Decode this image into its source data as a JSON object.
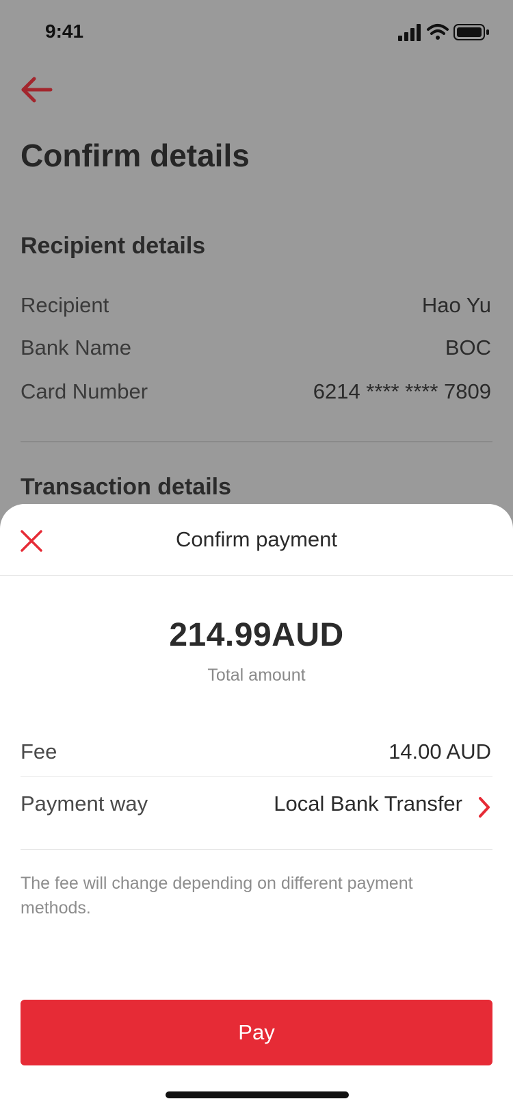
{
  "status_bar": {
    "time": "9:41"
  },
  "page": {
    "title": "Confirm details",
    "recipient_section": {
      "title": "Recipient details",
      "rows": [
        {
          "label": "Recipient",
          "value": "Hao Yu"
        },
        {
          "label": "Bank Name",
          "value": "BOC"
        },
        {
          "label": "Card Number",
          "value": "6214 **** **** 7809"
        }
      ]
    },
    "transaction_section": {
      "title": "Transaction details"
    }
  },
  "sheet": {
    "title": "Confirm payment",
    "amount": "214.99AUD",
    "amount_label": "Total amount",
    "fee": {
      "label": "Fee",
      "value": "14.00 AUD"
    },
    "payment_way": {
      "label": "Payment way",
      "value": "Local Bank Transfer"
    },
    "note": "The fee will change depending on different payment methods.",
    "pay_label": "Pay"
  },
  "colors": {
    "accent": "#e62b36",
    "overlay_bg": "#9a9a9a"
  },
  "icons": {
    "back": "arrow-left-icon",
    "close": "close-icon",
    "chevron": "chevron-right-icon",
    "signal": "cellular-signal-icon",
    "wifi": "wifi-icon",
    "battery": "battery-icon"
  }
}
